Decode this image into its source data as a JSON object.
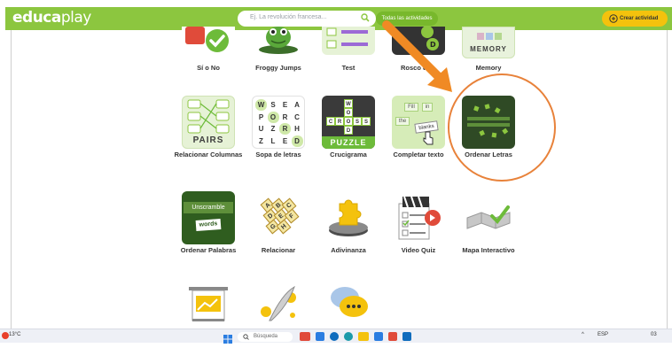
{
  "header": {
    "logo_bold": "educa",
    "logo_thin": "play",
    "search_placeholder": "Ej. La revolución francesa...",
    "filter_label": "Todas las actividades",
    "create_label": "Crear actividad"
  },
  "activities": [
    {
      "label": "Sí o No"
    },
    {
      "label": "Froggy Jumps"
    },
    {
      "label": "Test"
    },
    {
      "label": "Rosco de..."
    },
    {
      "label": "Memory"
    },
    {
      "label": "Relacionar Columnas"
    },
    {
      "label": "Sopa de letras"
    },
    {
      "label": "Crucigrama"
    },
    {
      "label": "Completar texto"
    },
    {
      "label": "Ordenar Letras"
    },
    {
      "label": "Ordenar Palabras"
    },
    {
      "label": "Relacionar"
    },
    {
      "label": "Adivinanza"
    },
    {
      "label": "Video Quiz"
    },
    {
      "label": "Mapa Interactivo"
    }
  ],
  "tile_text": {
    "memory": "MEMORY",
    "pairs": "PAIRS",
    "puzzle": "PUZZLE",
    "fill": "Fill",
    "in": "in",
    "the": "the",
    "blanks": "blanks",
    "unscramble": "Unscramble",
    "words": "words",
    "wordsearch": [
      "W",
      "S",
      "E",
      "A",
      "P",
      "O",
      "R",
      "C",
      "U",
      "Z",
      "R",
      "H",
      "Z",
      "L",
      "E",
      "D"
    ],
    "crossword": [
      "W",
      "O",
      "C",
      "R",
      "O",
      "S",
      "S",
      "D"
    ],
    "relacionar": [
      "A",
      "B",
      "C",
      "D",
      "E",
      "F",
      "G",
      "H"
    ]
  },
  "taskbar": {
    "weather": "13°C",
    "search": "Búsqueda",
    "lang": "ESP",
    "time": "03"
  },
  "colors": {
    "brand_green": "#8cc63f",
    "dark_green": "#2f5d1f",
    "highlight_circle": "#e8823a",
    "arrow": "#f08a24",
    "create_button": "#f4c20d"
  }
}
